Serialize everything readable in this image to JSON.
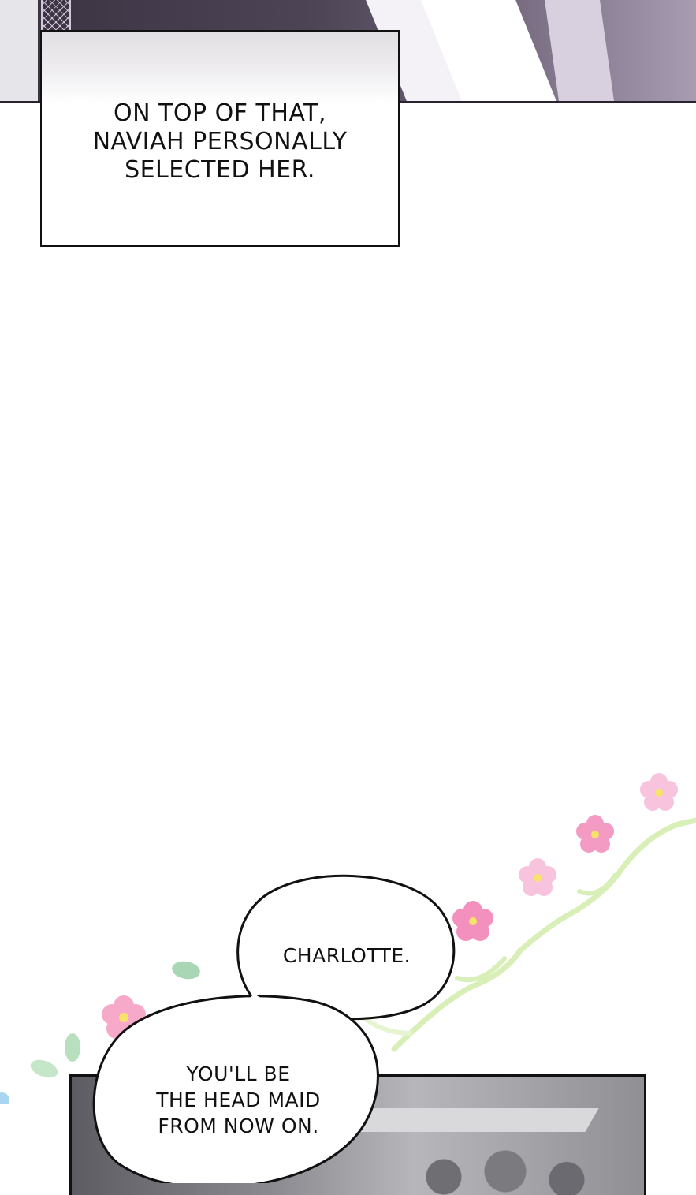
{
  "panels": {
    "narration": {
      "text": "ON TOP OF THAT,\nNAVIAH PERSONALLY\nSELECTED HER."
    },
    "speech_bubbles": [
      {
        "text": "CHARLOTTE."
      },
      {
        "text": "YOU'LL BE\nTHE HEAD MAID\nFROM NOW ON."
      }
    ]
  },
  "colors": {
    "flower_pink": "#f48fb8",
    "flower_center": "#f7e36a",
    "vine_green": "#d9efb8",
    "leaf_green": "#a9d6b5"
  }
}
